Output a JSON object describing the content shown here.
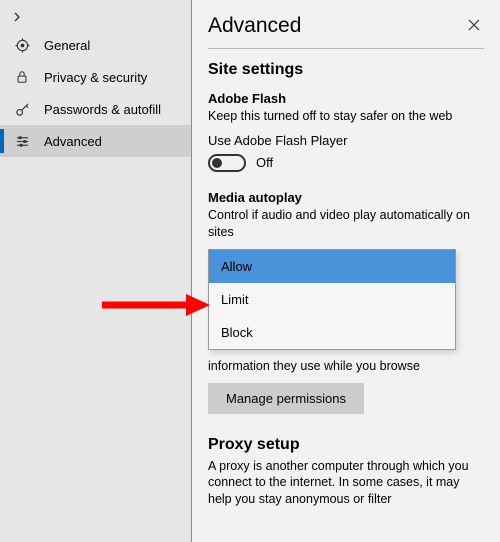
{
  "sidebar": {
    "items": [
      {
        "label": "General",
        "icon": "gear-icon"
      },
      {
        "label": "Privacy & security",
        "icon": "lock-icon"
      },
      {
        "label": "Passwords & autofill",
        "icon": "key-icon"
      },
      {
        "label": "Advanced",
        "icon": "sliders-icon"
      }
    ]
  },
  "header": {
    "title": "Advanced"
  },
  "site_settings": {
    "title": "Site settings",
    "flash": {
      "title": "Adobe Flash",
      "desc": "Keep this turned off to stay safer on the web",
      "use_label": "Use Adobe Flash Player",
      "toggle_state": "Off"
    },
    "autoplay": {
      "title": "Media autoplay",
      "desc": "Control if audio and video play automatically on sites",
      "options": [
        "Allow",
        "Limit",
        "Block"
      ],
      "selected": "Allow"
    },
    "under_dd": "information they use while you browse",
    "manage_label": "Manage permissions"
  },
  "proxy": {
    "title": "Proxy setup",
    "desc": "A proxy is another computer through which you connect to the internet. In some cases, it may help you stay anonymous or filter"
  }
}
